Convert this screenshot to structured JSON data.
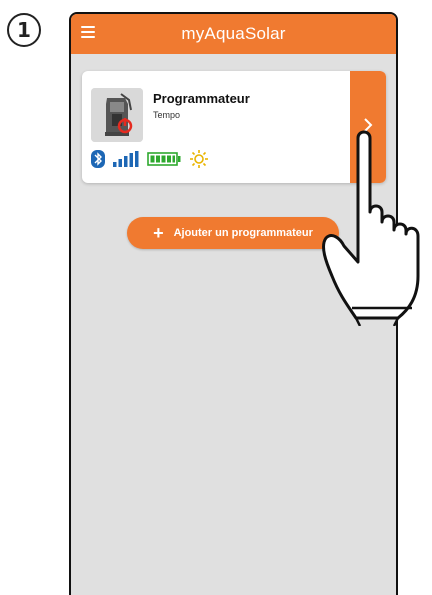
{
  "step": {
    "number": "1"
  },
  "app": {
    "title": "myAquaSolar",
    "menu_icon": "hamburger-menu-icon",
    "accent_color": "#f07a30",
    "background_color": "#e0e0e0"
  },
  "device_card": {
    "name": "Programmateur",
    "model": "Tempo",
    "status_icons": [
      "bluetooth-icon",
      "signal-strength-icon",
      "battery-full-icon",
      "sun-icon"
    ],
    "arrow_icon": "chevron-right-icon"
  },
  "add_button": {
    "icon": "plus-icon",
    "plus": "+",
    "label": "Ajouter un programmateur"
  },
  "overlay": {
    "icon": "pointing-hand-icon"
  }
}
